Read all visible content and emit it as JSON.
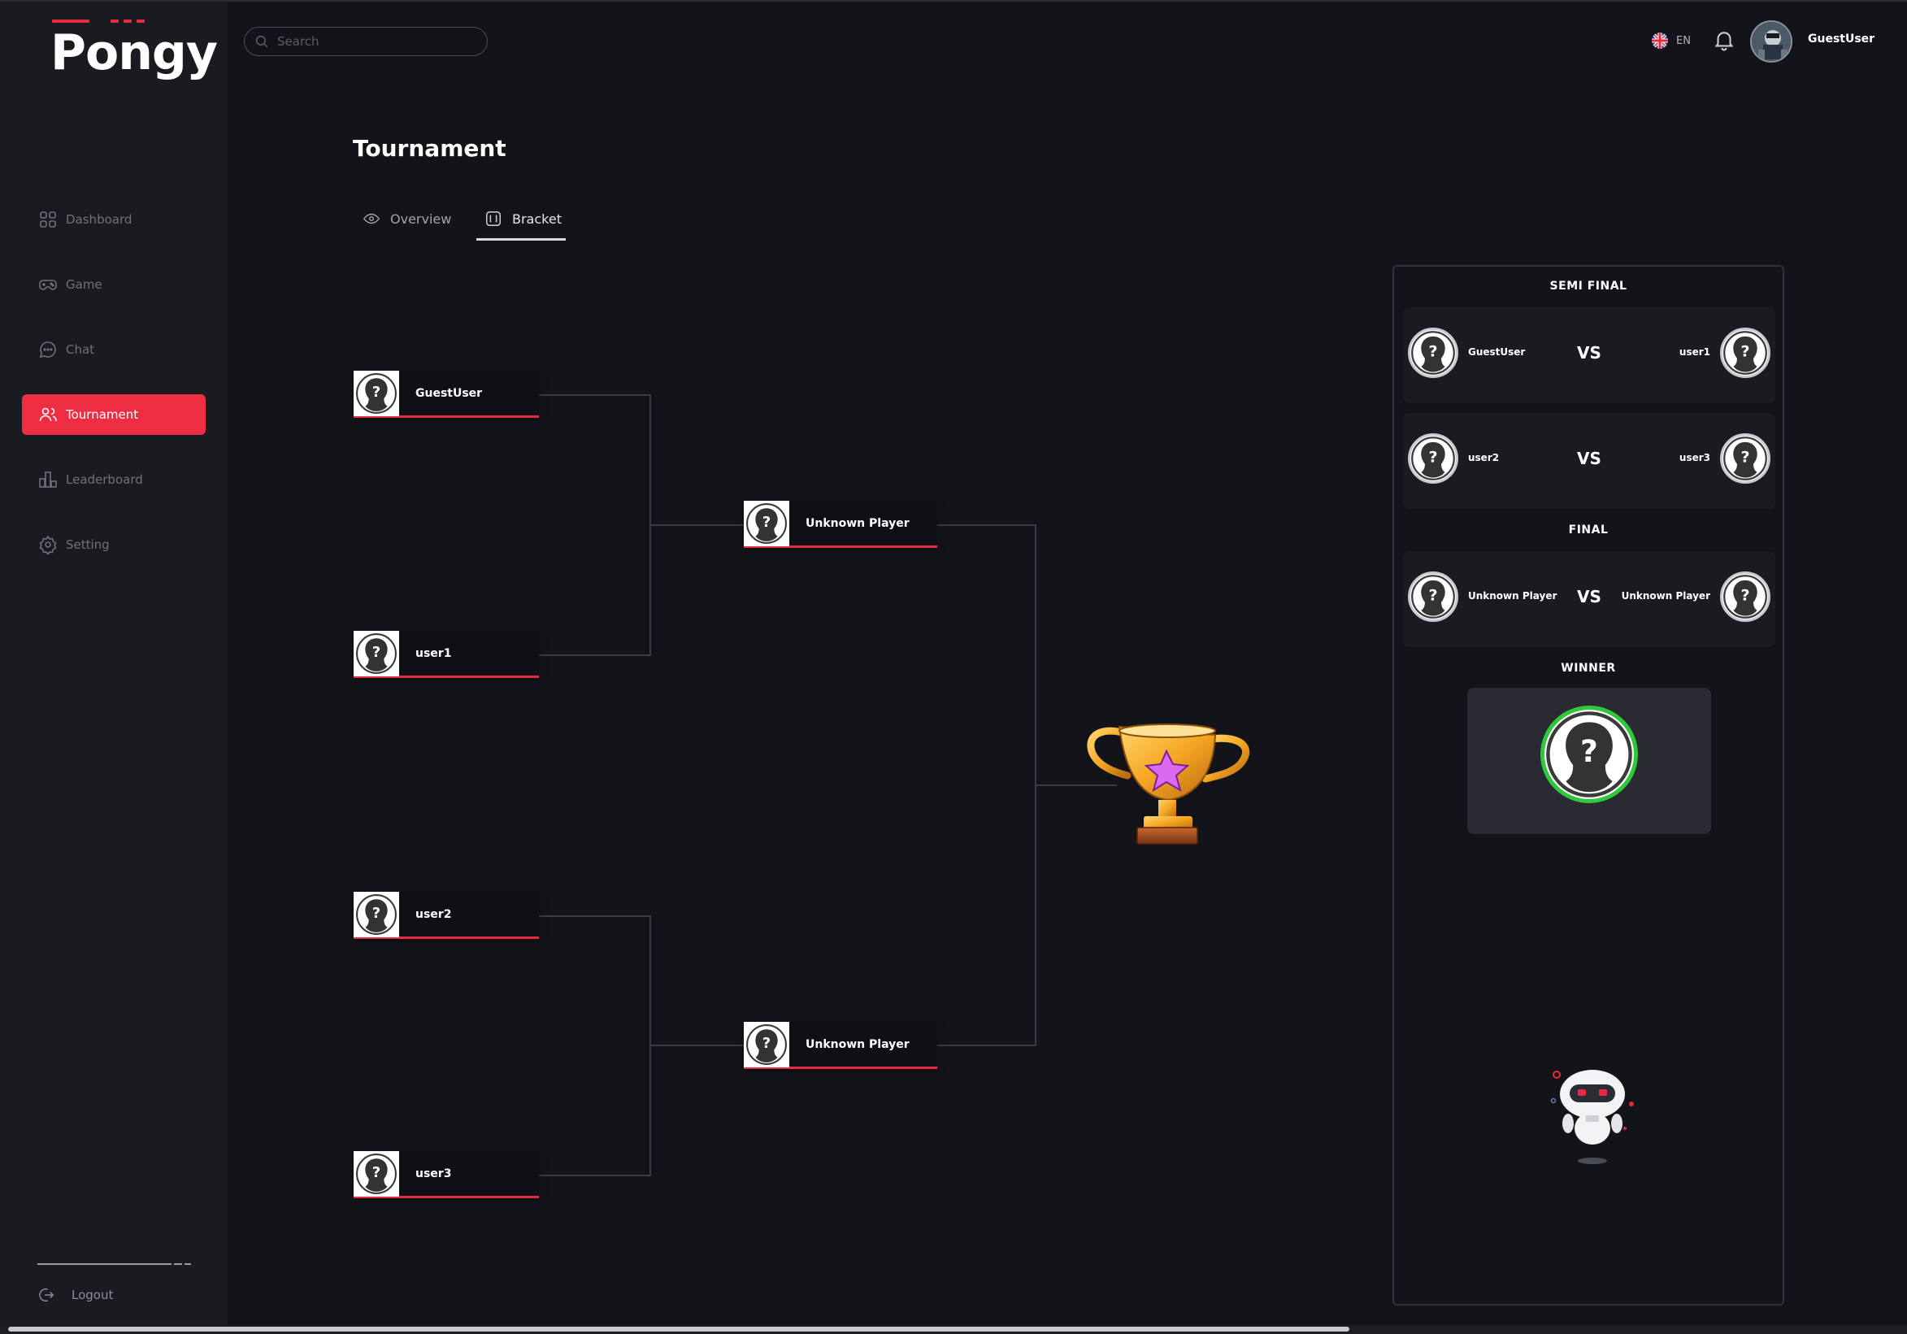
{
  "app": {
    "name": "Pongy"
  },
  "sidebar": {
    "items": [
      {
        "label": "Dashboard",
        "icon": "dashboard-icon"
      },
      {
        "label": "Game",
        "icon": "gamepad-icon"
      },
      {
        "label": "Chat",
        "icon": "chat-icon"
      },
      {
        "label": "Tournament",
        "icon": "users-icon",
        "active": true
      },
      {
        "label": "Leaderboard",
        "icon": "leaderboard-icon"
      },
      {
        "label": "Setting",
        "icon": "gear-icon"
      }
    ],
    "logout_label": "Logout"
  },
  "topbar": {
    "search_placeholder": "Search",
    "language": "EN",
    "username": "GuestUser"
  },
  "page": {
    "title": "Tournament",
    "tabs": [
      {
        "label": "Overview",
        "icon": "eye-icon"
      },
      {
        "label": "Bracket",
        "icon": "bracket-icon",
        "active": true
      }
    ]
  },
  "bracket": {
    "round1": [
      "GuestUser",
      "user1",
      "user2",
      "user3"
    ],
    "round2": [
      "Unknown Player",
      "Unknown Player"
    ]
  },
  "panel": {
    "semi_final_heading": "SEMI FINAL",
    "final_heading": "FINAL",
    "winner_heading": "WINNER",
    "vs_label": "VS",
    "semi_finals": [
      {
        "left": "GuestUser",
        "right": "user1"
      },
      {
        "left": "user2",
        "right": "user3"
      }
    ],
    "final": {
      "left": "Unknown Player",
      "right": "Unknown Player"
    }
  },
  "colors": {
    "accent": "#ee2d43",
    "background": "#13141a",
    "sidebar": "#1a1b21",
    "winner_ring": "#2ec83b"
  }
}
